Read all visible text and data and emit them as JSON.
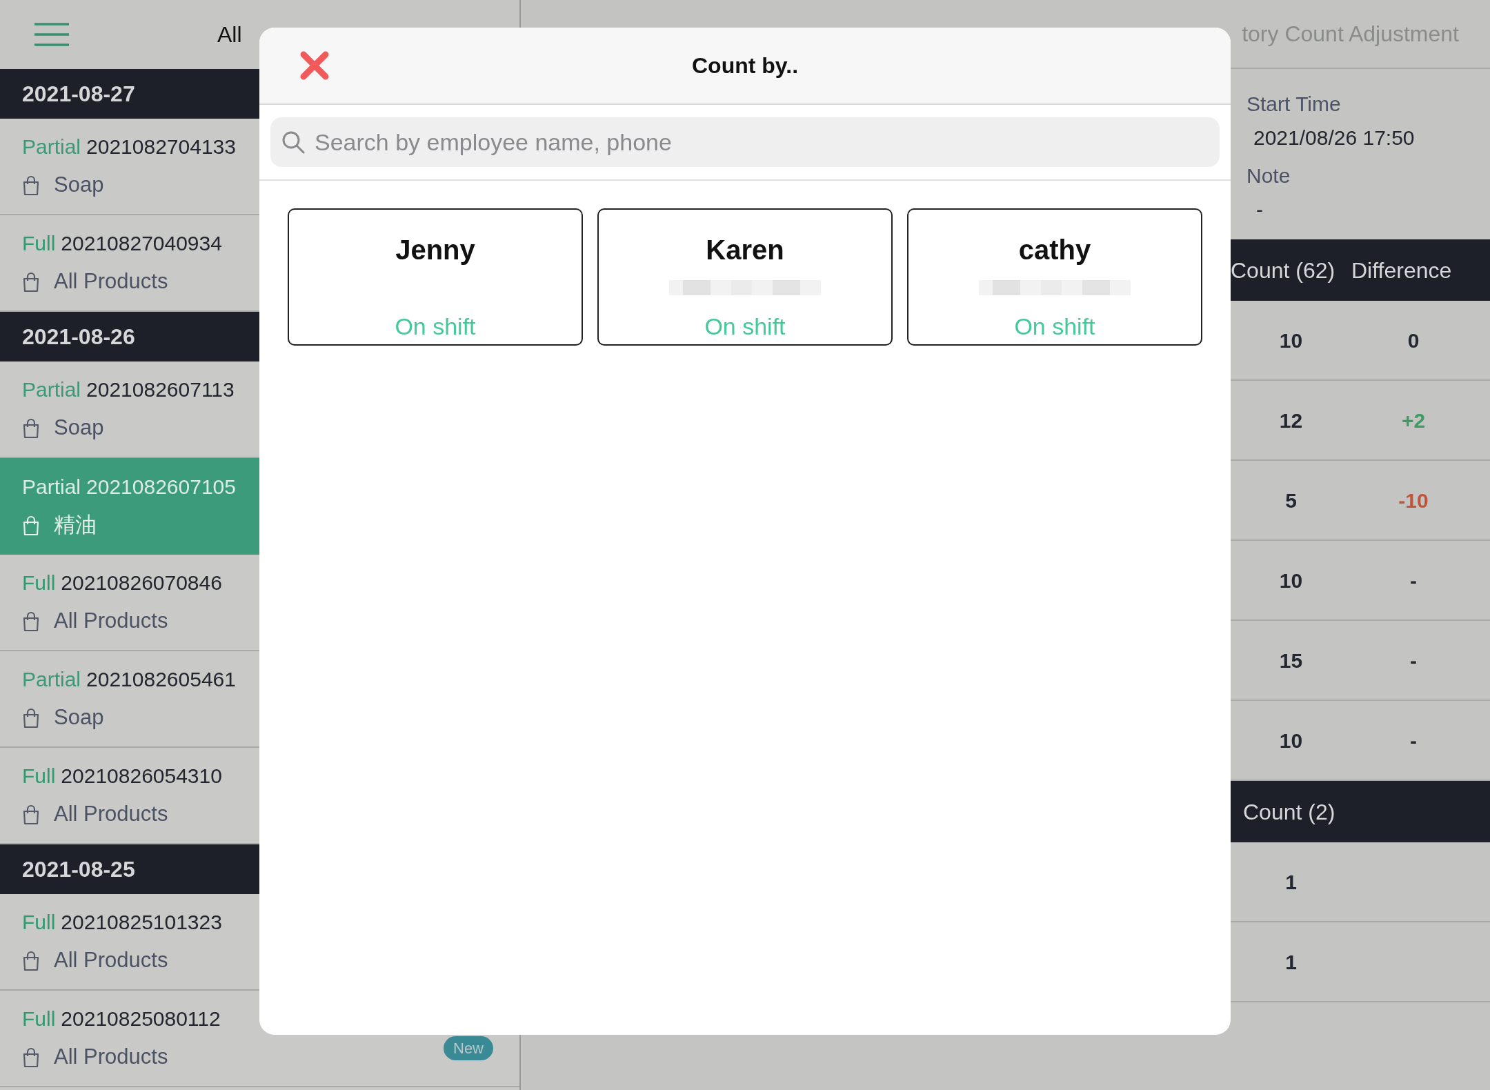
{
  "header": {
    "filter": "All",
    "title": "tory Count Adjustment"
  },
  "groups": [
    {
      "date": "2021-08-27",
      "items": [
        {
          "kind": "partial",
          "type_label": "Partial",
          "id": "2021082704133",
          "category": "Soap",
          "selected": false
        },
        {
          "kind": "full",
          "type_label": "Full",
          "id": "20210827040934",
          "category": "All Products",
          "selected": false
        }
      ]
    },
    {
      "date": "2021-08-26",
      "items": [
        {
          "kind": "partial",
          "type_label": "Partial",
          "id": "2021082607113",
          "category": "Soap",
          "selected": false
        },
        {
          "kind": "partial",
          "type_label": "Partial",
          "id": "2021082607105",
          "category": "精油",
          "selected": true
        },
        {
          "kind": "full",
          "type_label": "Full",
          "id": "20210826070846",
          "category": "All Products",
          "selected": false
        },
        {
          "kind": "partial",
          "type_label": "Partial",
          "id": "2021082605461",
          "category": "Soap",
          "selected": false
        },
        {
          "kind": "full",
          "type_label": "Full",
          "id": "20210826054310",
          "category": "All Products",
          "selected": false
        }
      ]
    },
    {
      "date": "2021-08-25",
      "items": [
        {
          "kind": "full",
          "type_label": "Full",
          "id": "20210825101323",
          "category": "All Products",
          "selected": false
        },
        {
          "kind": "full",
          "type_label": "Full",
          "id": "20210825080112",
          "category": "All Products",
          "selected": false,
          "badge": "New"
        }
      ]
    }
  ],
  "details": {
    "start_time_label": "Start Time",
    "start_time": "2021/08/26 17:50",
    "note_label": "Note",
    "note": "-"
  },
  "tables": [
    {
      "columns": [
        "Count (62)",
        "Difference"
      ],
      "rows": [
        {
          "count": "10",
          "difference": "0",
          "kind": "neutral"
        },
        {
          "count": "12",
          "difference": "+2",
          "kind": "positive"
        },
        {
          "count": "5",
          "difference": "-10",
          "kind": "negative"
        },
        {
          "count": "10",
          "difference": "-",
          "kind": "neutral"
        },
        {
          "count": "15",
          "difference": "-",
          "kind": "neutral"
        },
        {
          "count": "10",
          "difference": "-",
          "kind": "neutral"
        }
      ]
    },
    {
      "columns": [
        "Count (2)"
      ],
      "rows": [
        {
          "count": "1"
        },
        {
          "count": "1"
        }
      ]
    }
  ],
  "modal": {
    "title": "Count by..",
    "search_placeholder": "Search by employee name, phone",
    "employees": [
      {
        "name": "Jenny",
        "phone_blurred": false,
        "status": "On shift"
      },
      {
        "name": "Karen",
        "phone_blurred": true,
        "status": "On shift"
      },
      {
        "name": "cathy",
        "phone_blurred": true,
        "status": "On shift"
      }
    ]
  }
}
